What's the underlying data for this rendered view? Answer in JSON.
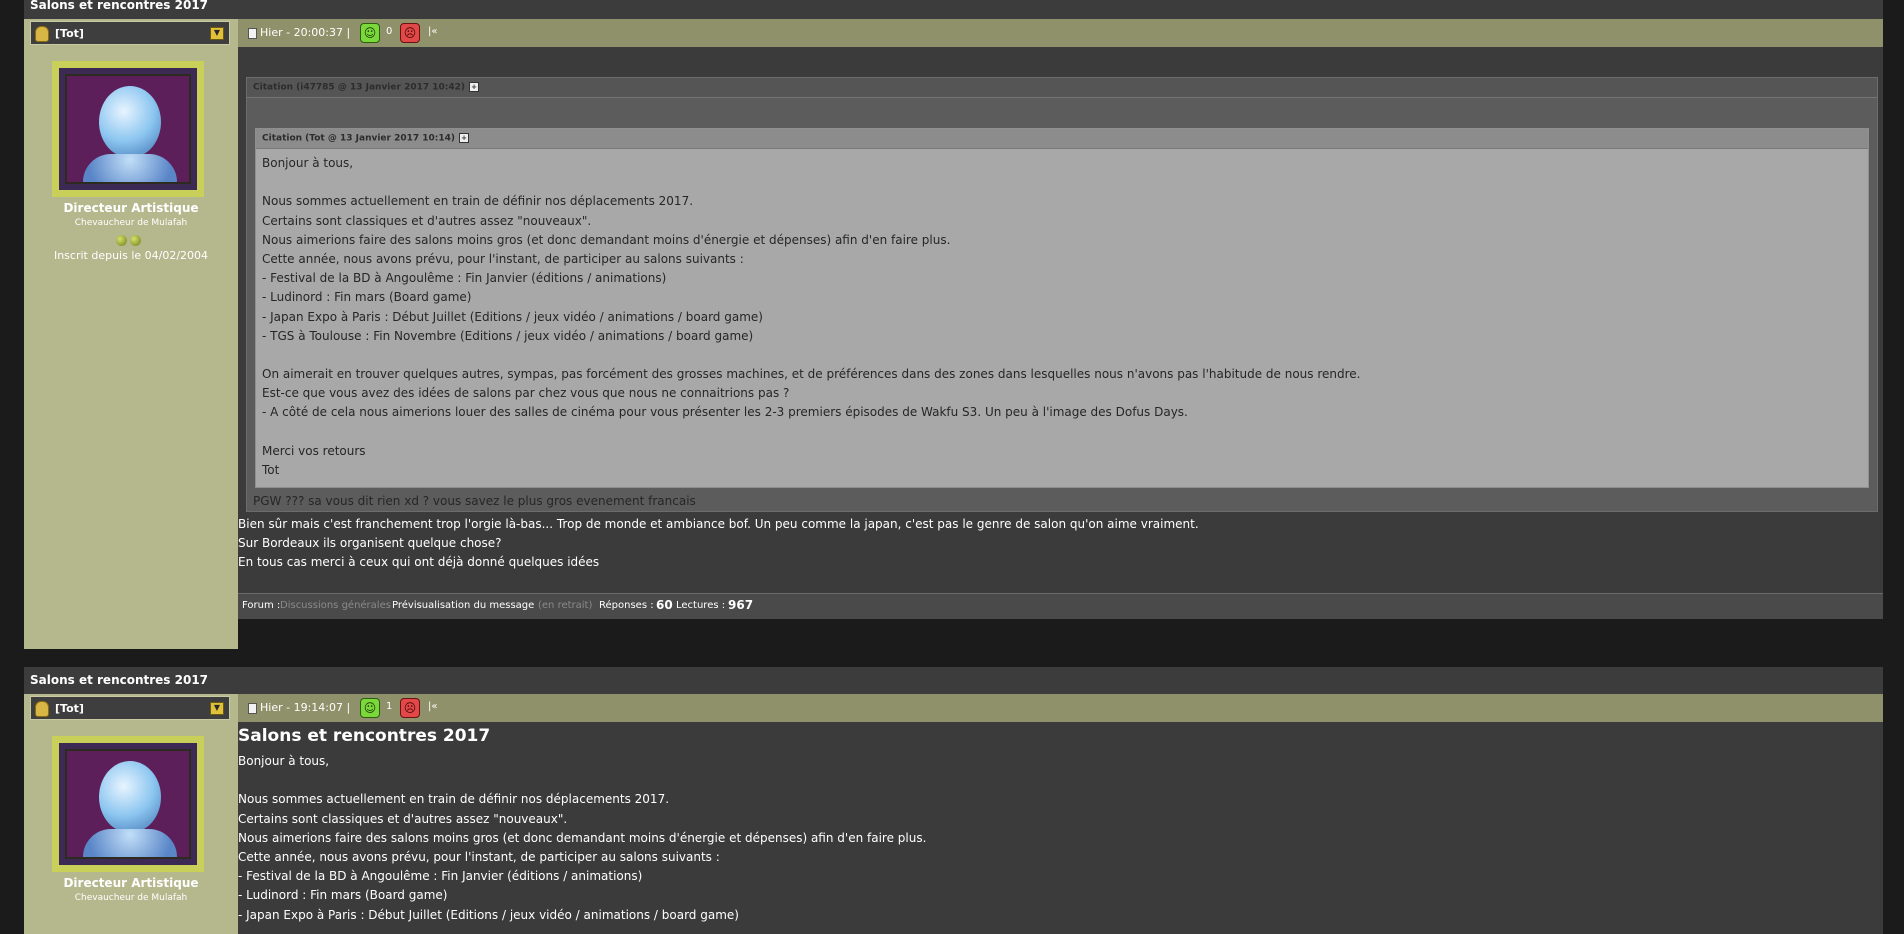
{
  "posts": [
    {
      "title": "Salons et rencontres 2017",
      "user": {
        "name": "[Tot]",
        "rank": "Directeur Artistique",
        "subrank": "Chevaucheur de Mulafah",
        "since": "Inscrit depuis le 04/02/2004"
      },
      "meta": {
        "date": "Hier - 20:00:37 |",
        "up": "0"
      },
      "quote_outer_label": "Citation (i47785 @ 13 Janvier 2017 10:42)",
      "quote_inner_label": "Citation (Tot @ 13 Janvier 2017 10:14)",
      "quote_lines": [
        "Bonjour à tous,",
        "",
        "Nous sommes actuellement en train de définir nos déplacements 2017.",
        "Certains sont classiques et d'autres assez \"nouveaux\".",
        "Nous aimerions faire des salons moins gros (et donc demandant moins d'énergie et dépenses) afin d'en faire plus.",
        "Cette année, nous avons prévu, pour l'instant, de participer au salons suivants :",
        "- Festival de la BD à Angoulême : Fin Janvier (éditions / animations)",
        "- Ludinord : Fin mars (Board game)",
        "- Japan Expo à Paris : Début Juillet (Editions / jeux vidéo / animations / board game)",
        "- TGS à Toulouse : Fin Novembre (Editions / jeux vidéo / animations / board game)",
        "",
        "On aimerait en trouver quelques autres, sympas, pas forcément des grosses machines, et de préférences dans des zones dans lesquelles nous n'avons pas l'habitude de nous rendre.",
        "Est-ce que vous avez des idées de salons par chez vous que nous ne connaitrions pas ?",
        "- A côté de cela nous aimerions louer des salles de cinéma pour vous présenter les 2-3 premiers épisodes de Wakfu S3. Un peu à l'image des Dofus Days.",
        "",
        "Merci vos retours",
        "Tot"
      ],
      "quote_tail": "PGW ??? sa vous dit rien xd ? vous savez le plus gros evenement francais",
      "reply_lines": [
        "Bien sûr mais c'est franchement trop l'orgie là-bas... Trop de monde et ambiance bof. Un peu comme la japan, c'est pas le genre de salon qu'on aime vraiment.",
        "Sur Bordeaux ils organisent quelque chose?",
        "En tous cas merci à ceux qui ont déjà donné quelques idées"
      ],
      "stats": {
        "forum_label": "Forum :",
        "forum_value": "Discussions générales",
        "preview": "Prévisualisation du message",
        "preview_value": "(en retrait)",
        "replies_label": "Réponses :",
        "replies": "60",
        "reads_label": "Lectures :",
        "reads": "967"
      }
    },
    {
      "title": "Salons et rencontres 2017",
      "user": {
        "name": "[Tot]",
        "rank": "Directeur Artistique",
        "subrank": "Chevaucheur de Mulafah"
      },
      "meta": {
        "date": "Hier - 19:14:07 |",
        "up": "1"
      },
      "heading": "Salons et rencontres 2017",
      "body_lines": [
        "Bonjour à tous,",
        "",
        "Nous sommes actuellement en train de définir nos déplacements 2017.",
        "Certains sont classiques et d'autres assez \"nouveaux\".",
        "Nous aimerions faire des salons moins gros (et donc demandant moins d'énergie et dépenses) afin d'en faire plus.",
        "Cette année, nous avons prévu, pour l'instant, de participer au salons suivants :",
        "- Festival de la BD à Angoulême : Fin Janvier (éditions / animations)",
        "- Ludinord : Fin mars (Board game)",
        "- Japan Expo à Paris : Début Juillet (Editions / jeux vidéo / animations / board game)"
      ]
    }
  ],
  "icons": {
    "medal": "medal-icon",
    "dropdown": "dropdown-icon",
    "document": "document-icon",
    "vote_up": "smiley-up-icon",
    "vote_down": "smiley-down-icon",
    "reply": "quote-reply-icon",
    "expand": "expand-icon"
  },
  "colors": {
    "user_column": "#b5b78d",
    "meta_bar": "#8f916a",
    "content_bg": "#3b3b3b",
    "vote_up": "#7bd83a",
    "vote_down": "#e24848",
    "avatar_frame": "#c9d05a"
  }
}
